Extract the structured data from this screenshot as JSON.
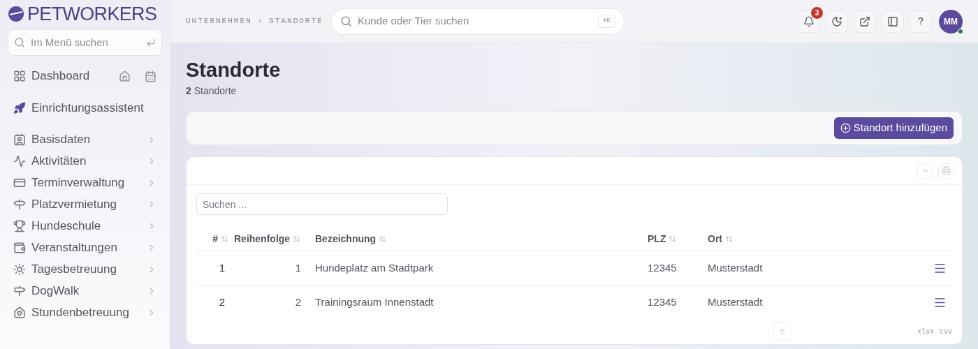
{
  "sidebar": {
    "logo": "PETWORKERS",
    "search": {
      "placeholder": "Im Menü suchen"
    },
    "top_items": [
      {
        "label": "Dashboard"
      },
      {
        "label": "Einrichtungsassistent"
      }
    ],
    "items": [
      {
        "label": "Basisdaten",
        "expanded": false
      },
      {
        "label": "Aktivitäten",
        "expanded": false
      },
      {
        "label": "Terminverwaltung",
        "expanded": false
      },
      {
        "label": "Platzvermietung",
        "expanded": false
      },
      {
        "label": "Hundeschule",
        "expanded": false
      },
      {
        "label": "Veranstaltungen",
        "expanded": false
      },
      {
        "label": "Tagesbetreuung",
        "expanded": false
      },
      {
        "label": "DogWalk",
        "expanded": false
      },
      {
        "label": "Stundenbetreuung",
        "expanded": false
      }
    ]
  },
  "header": {
    "breadcrumb": [
      "UNTERNEHMEN",
      "STANDORTE"
    ],
    "breadcrumb_separator": "›",
    "search": {
      "placeholder": "Kunde oder Tier suchen",
      "shortcut": "⌘K"
    },
    "notifications": "3",
    "help": "?",
    "avatar": "MM",
    "online": true
  },
  "page": {
    "title": "Standorte",
    "subtitle": "**2** Standorte",
    "add_button": "Standort hinzufügen"
  },
  "table": {
    "search": {
      "placeholder": "Suchen ..."
    },
    "columns": [
      "#",
      "Reihenfolge",
      "Bezeichnung",
      "PLZ",
      "Ort"
    ],
    "rows": [
      {
        "cells": [
          "1",
          "1",
          "Hundeplatz am Stadtpark",
          "12345",
          "Musterstadt"
        ]
      },
      {
        "cells": [
          "2",
          "2",
          "Trainingsraum Innenstadt",
          "12345",
          "Musterstadt"
        ]
      }
    ],
    "exports": [
      "xlsx",
      "csv"
    ]
  }
}
